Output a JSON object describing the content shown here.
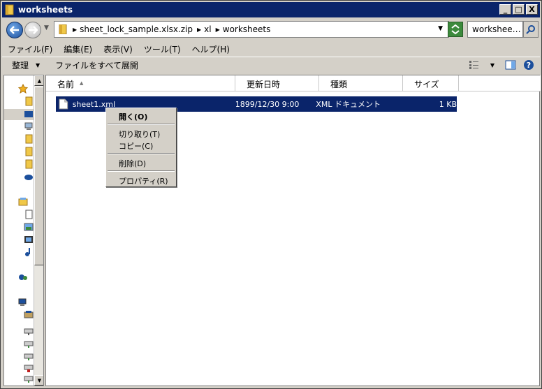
{
  "window": {
    "title": "worksheets",
    "minimize_label": "_",
    "maximize_label": "□",
    "close_label": "X"
  },
  "address": {
    "segments": [
      "sheet_lock_sample.xlsx.zip",
      "xl",
      "worksheets"
    ],
    "search_placeholder": "workshee…"
  },
  "menu": [
    "ファイル(F)",
    "編集(E)",
    "表示(V)",
    "ツール(T)",
    "ヘルプ(H)"
  ],
  "commands": {
    "organize": "整理",
    "extract_all": "ファイルをすべて展開"
  },
  "columns": [
    "名前",
    "更新日時",
    "種類",
    "サイズ"
  ],
  "files": [
    {
      "name": "sheet1.xml",
      "modified": "1899/12/30 9:00",
      "type": "XML ドキュメント",
      "size": "1 KB"
    }
  ],
  "context_menu": {
    "open": "開く(O)",
    "cut": "切り取り(T)",
    "copy": "コピー(C)",
    "delete": "削除(D)",
    "properties": "プロパティ(R)"
  },
  "colors": {
    "selection": "#0a246a",
    "titlebar": "#0a246a",
    "chrome": "#d4d0c8"
  }
}
